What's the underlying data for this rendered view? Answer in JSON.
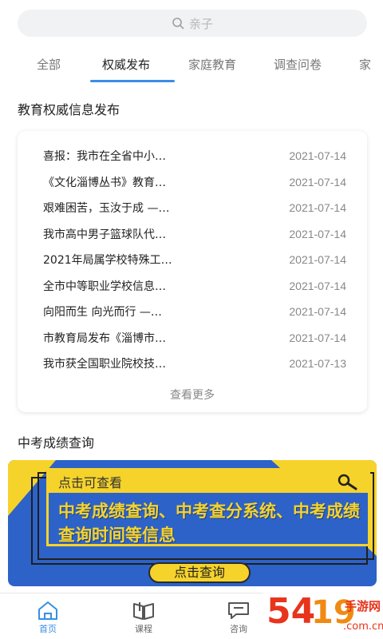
{
  "search": {
    "placeholder": "亲子"
  },
  "tabs": [
    {
      "label": "全部"
    },
    {
      "label": "权威发布"
    },
    {
      "label": "家庭教育"
    },
    {
      "label": "调查问卷"
    },
    {
      "label": "家"
    }
  ],
  "section_news": {
    "title": "教育权威信息发布"
  },
  "news": [
    {
      "title": "喜报：我市在全省中小…",
      "date": "2021-07-14"
    },
    {
      "title": "《文化淄博丛书》教育…",
      "date": "2021-07-14"
    },
    {
      "title": "艰难困苦，玉汝于成 —…",
      "date": "2021-07-14"
    },
    {
      "title": "我市高中男子篮球队代…",
      "date": "2021-07-14"
    },
    {
      "title": "2021年局属学校特殊工…",
      "date": "2021-07-14"
    },
    {
      "title": "全市中等职业学校信息…",
      "date": "2021-07-14"
    },
    {
      "title": "向阳而生 向光而行 —…",
      "date": "2021-07-14"
    },
    {
      "title": "市教育局发布《淄博市…",
      "date": "2021-07-14"
    },
    {
      "title": "我市获全国职业院校技…",
      "date": "2021-07-13"
    }
  ],
  "news_more": "查看更多",
  "section_exam": {
    "title": "中考成绩查询"
  },
  "banner": {
    "head": "点击可查看",
    "body": "中考成绩查询、中考查分系统、中考成绩查询时间等信息",
    "button": "点击查询"
  },
  "tabbar": [
    {
      "label": "首页",
      "icon": "home-icon"
    },
    {
      "label": "课程",
      "icon": "book-icon"
    },
    {
      "label": "咨询",
      "icon": "chat-icon"
    }
  ],
  "watermark": "5419手游网",
  "colors": {
    "accent": "#3a8ee6",
    "banner_blue": "#2d63c8",
    "banner_yellow": "#f6d32b"
  }
}
